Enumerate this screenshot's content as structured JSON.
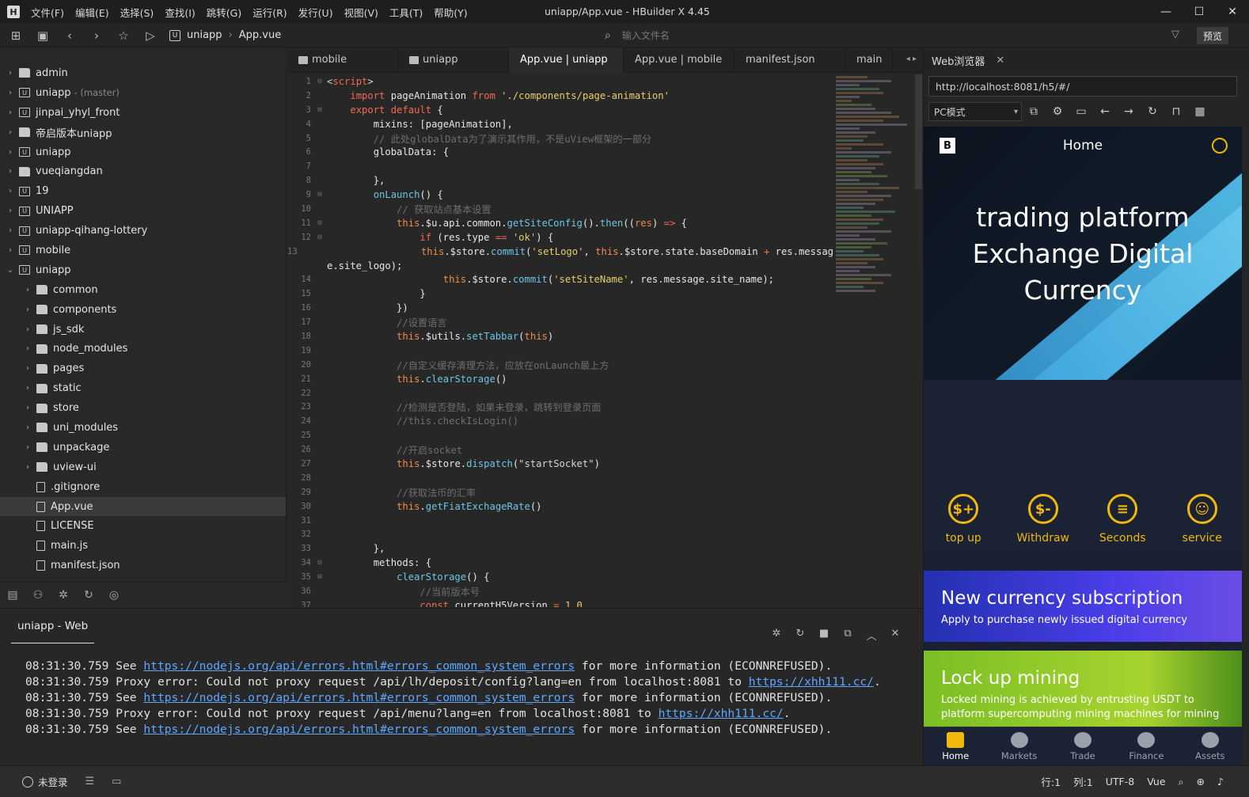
{
  "window": {
    "title": "uniapp/App.vue - HBuilder X 4.45",
    "menu": [
      "文件(F)",
      "编辑(E)",
      "选择(S)",
      "查找(I)",
      "跳转(G)",
      "运行(R)",
      "发行(U)",
      "视图(V)",
      "工具(T)",
      "帮助(Y)"
    ],
    "controls": [
      "—",
      "☐",
      "✕"
    ]
  },
  "toolbar": {
    "crumbs": [
      "uniapp",
      "App.vue"
    ],
    "file_search_placeholder": "输入文件名",
    "preview_label": "预览"
  },
  "sidebar": {
    "items": [
      {
        "label": "admin",
        "level": 0,
        "type": "folder",
        "expand": "›"
      },
      {
        "label": "uniapp",
        "level": 0,
        "type": "project",
        "branch": "- (master)",
        "expand": "›"
      },
      {
        "label": "jinpai_yhyl_front",
        "level": 0,
        "type": "project",
        "expand": "›"
      },
      {
        "label": "帝启版本uniapp",
        "level": 0,
        "type": "folder",
        "expand": "›"
      },
      {
        "label": "uniapp",
        "level": 0,
        "type": "project",
        "expand": "›"
      },
      {
        "label": "vueqiangdan",
        "level": 0,
        "type": "folder",
        "expand": "›"
      },
      {
        "label": "19",
        "level": 0,
        "type": "project",
        "expand": "›"
      },
      {
        "label": "UNIAPP",
        "level": 0,
        "type": "project",
        "expand": "›"
      },
      {
        "label": "uniapp-qihang-lottery",
        "level": 0,
        "type": "project",
        "expand": "›"
      },
      {
        "label": "mobile",
        "level": 0,
        "type": "project",
        "expand": "›"
      },
      {
        "label": "uniapp",
        "level": 0,
        "type": "project",
        "expand": "⌄"
      },
      {
        "label": "common",
        "level": 1,
        "type": "folder",
        "expand": "›"
      },
      {
        "label": "components",
        "level": 1,
        "type": "folder",
        "expand": "›"
      },
      {
        "label": "js_sdk",
        "level": 1,
        "type": "folder",
        "expand": "›"
      },
      {
        "label": "node_modules",
        "level": 1,
        "type": "folder",
        "expand": "›"
      },
      {
        "label": "pages",
        "level": 1,
        "type": "folder",
        "expand": "›"
      },
      {
        "label": "static",
        "level": 1,
        "type": "folder",
        "expand": "›"
      },
      {
        "label": "store",
        "level": 1,
        "type": "folder",
        "expand": "›"
      },
      {
        "label": "uni_modules",
        "level": 1,
        "type": "folder",
        "expand": "›"
      },
      {
        "label": "unpackage",
        "level": 1,
        "type": "folder",
        "expand": "›"
      },
      {
        "label": "uview-ui",
        "level": 1,
        "type": "folder",
        "expand": "›"
      },
      {
        "label": ".gitignore",
        "level": 1,
        "type": "file",
        "expand": ""
      },
      {
        "label": "App.vue",
        "level": 1,
        "type": "file",
        "expand": "",
        "selected": true
      },
      {
        "label": "LICENSE",
        "level": 1,
        "type": "file",
        "expand": ""
      },
      {
        "label": "main.js",
        "level": 1,
        "type": "file",
        "expand": ""
      },
      {
        "label": "manifest.json",
        "level": 1,
        "type": "file",
        "expand": ""
      }
    ]
  },
  "editor": {
    "tabs": [
      {
        "label": "mobile",
        "icon": true
      },
      {
        "label": "uniapp",
        "icon": true
      },
      {
        "label": "App.vue | uniapp",
        "active": true
      },
      {
        "label": "App.vue | mobile"
      },
      {
        "label": "manifest.json"
      },
      {
        "label": "main"
      }
    ],
    "lines": [
      {
        "n": "1",
        "fold": "⊟",
        "html": "<span class='p'>&lt;</span><span class='tg'>script</span><span class='p'>&gt;</span>"
      },
      {
        "n": "2",
        "html": "    <span class='k'>import</span> pageAnimation <span class='k'>from</span> <span class='s'>'./components/page-animation'</span>"
      },
      {
        "n": "3",
        "fold": "⊟",
        "html": "    <span class='k'>export default</span> {"
      },
      {
        "n": "4",
        "html": "        mixins: [pageAnimation],"
      },
      {
        "n": "5",
        "html": "        <span class='c'>// 此处globalData为了演示其作用，不是uView框架的一部分</span>"
      },
      {
        "n": "6",
        "html": "        globalData: {"
      },
      {
        "n": "7",
        "html": ""
      },
      {
        "n": "8",
        "html": "        },"
      },
      {
        "n": "9",
        "fold": "⊟",
        "html": "        <span class='f'>onLaunch</span>() {"
      },
      {
        "n": "10",
        "html": "            <span class='c'>// 获取站点基本设置</span>"
      },
      {
        "n": "11",
        "fold": "⊟",
        "html": "            <span class='th'>this</span>.$u.api.common.<span class='f'>getSiteConfig</span>().<span class='f'>then</span>((<span class='th'>res</span>) <span class='k'>=&gt;</span> {"
      },
      {
        "n": "12",
        "fold": "⊟",
        "html": "                <span class='k'>if</span> (res.type <span class='k'>==</span> <span class='s'>'ok'</span>) {"
      },
      {
        "n": "13",
        "html": "                    <span class='th'>this</span>.$store.<span class='f'>commit</span>(<span class='s'>'setLogo'</span>, <span class='th'>this</span>.$store.state.baseDomain <span class='k'>+</span> res.messag"
      },
      {
        "n": "",
        "html": "e.site_logo);"
      },
      {
        "n": "14",
        "html": "                    <span class='th'>this</span>.$store.<span class='f'>commit</span>(<span class='s'>'setSiteName'</span>, res.message.site_name);"
      },
      {
        "n": "15",
        "html": "                }"
      },
      {
        "n": "16",
        "html": "            })"
      },
      {
        "n": "17",
        "html": "            <span class='c'>//设置语言</span>"
      },
      {
        "n": "18",
        "html": "            <span class='th'>this</span>.$utils.<span class='f'>setTabbar</span>(<span class='th'>this</span>)"
      },
      {
        "n": "19",
        "html": ""
      },
      {
        "n": "20",
        "html": "            <span class='c'>//自定义缓存清理方法，应放在onLaunch最上方</span>"
      },
      {
        "n": "21",
        "html": "            <span class='th'>this</span>.<span class='f'>clearStorage</span>()"
      },
      {
        "n": "22",
        "html": ""
      },
      {
        "n": "23",
        "html": "            <span class='c'>//检测是否登陆，如果未登录，跳转到登录页面</span>"
      },
      {
        "n": "24",
        "html": "            <span class='c'>//this.checkIsLogin()</span>"
      },
      {
        "n": "25",
        "html": ""
      },
      {
        "n": "26",
        "html": "            <span class='c'>//开启socket</span>"
      },
      {
        "n": "27",
        "html": "            <span class='th'>this</span>.$store.<span class='f'>dispatch</span>(<span class='p'>\"startSocket\"</span>)"
      },
      {
        "n": "28",
        "html": ""
      },
      {
        "n": "29",
        "html": "            <span class='c'>//获取法币的汇率</span>"
      },
      {
        "n": "30",
        "html": "            <span class='th'>this</span>.<span class='f'>getFiatExchageRate</span>()"
      },
      {
        "n": "31",
        "html": ""
      },
      {
        "n": "32",
        "html": ""
      },
      {
        "n": "33",
        "html": "        },"
      },
      {
        "n": "34",
        "fold": "⊟",
        "html": "        methods: {"
      },
      {
        "n": "35",
        "fold": "⊟",
        "html": "            <span class='f'>clearStorage</span>() {"
      },
      {
        "n": "36",
        "html": "                <span class='c'>//当前版本号</span>"
      },
      {
        "n": "37",
        "html": "                <span class='k'>const</span> currentH5Version <span class='k'>=</span> <span class='s'>1.0</span>"
      }
    ]
  },
  "browser": {
    "tab_label": "Web浏览器",
    "url": "http://localhost:8081/h5/#/",
    "mode": "PC模式",
    "app": {
      "header_title": "Home",
      "logo_letter": "B",
      "hero_lines": [
        "trading platform",
        "Exchange Digital",
        "Currency"
      ],
      "quick": [
        {
          "label": "top up",
          "glyph": "$+"
        },
        {
          "label": "Withdraw",
          "glyph": "$-"
        },
        {
          "label": "Seconds",
          "glyph": "≡"
        },
        {
          "label": "service",
          "glyph": "☺"
        }
      ],
      "banner1": {
        "title": "New currency subscription",
        "sub": "Apply to purchase newly issued digital currency"
      },
      "banner2": {
        "title": "Lock up mining",
        "sub": "Locked mining is achieved by entrusting USDT to platform supercomputing mining machines for mining"
      },
      "tabbar": [
        "Home",
        "Markets",
        "Trade",
        "Finance",
        "Assets"
      ]
    }
  },
  "console": {
    "tab_label": "uniapp - Web",
    "logs": [
      {
        "time": "08:31:30.759",
        "pre": "See ",
        "link": "https://nodejs.org/api/errors.html#errors_common_system_errors",
        "post": " for more information (ECONNREFUSED)."
      },
      {
        "time": "08:31:30.759",
        "pre": "Proxy error: Could not proxy request /api/lh/deposit/config?lang=en from localhost:8081 to ",
        "link": "https://xhh111.cc/",
        "post": "."
      },
      {
        "time": "08:31:30.759",
        "pre": "See ",
        "link": "https://nodejs.org/api/errors.html#errors_common_system_errors",
        "post": " for more information (ECONNREFUSED)."
      },
      {
        "time": "08:31:30.759",
        "pre": "Proxy error: Could not proxy request /api/menu?lang=en from localhost:8081 to ",
        "link": "https://xhh111.cc/",
        "post": "."
      },
      {
        "time": "08:31:30.759",
        "pre": "See ",
        "link": "https://nodejs.org/api/errors.html#errors_common_system_errors",
        "post": " for more information (ECONNREFUSED)."
      }
    ]
  },
  "statusbar": {
    "login": "未登录",
    "row": "行:1",
    "col": "列:1",
    "encoding": "UTF-8",
    "lang": "Vue"
  }
}
